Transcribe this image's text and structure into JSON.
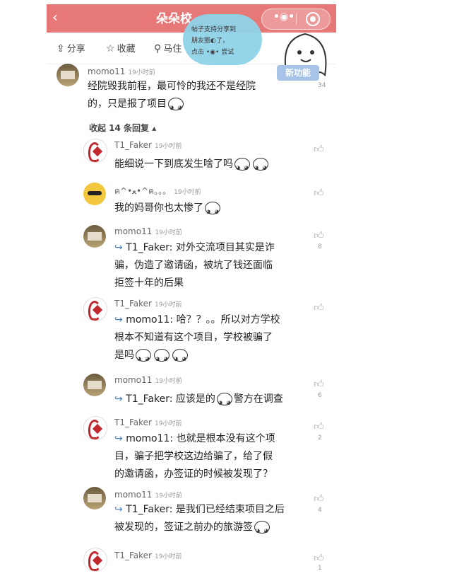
{
  "header": {
    "title": "朵朵校",
    "back_icon": "back-arrow-icon"
  },
  "actions": [
    {
      "label": "分享",
      "icon": "share-icon"
    },
    {
      "label": "收藏",
      "icon": "star-icon"
    },
    {
      "label": "马住",
      "icon": "pin-icon"
    }
  ],
  "tooltip": {
    "line1": "帖子支持分享到",
    "line2": "朋友圈",
    "line3": "了，",
    "line4": "点击",
    "line5": "尝试"
  },
  "new_feature_label": "新功能",
  "main_comment": {
    "name": "momo11",
    "time": "19小时前",
    "text_l1": "经院毁我前程，最可怜的我还不是经院",
    "text_l2": "的，只是报了项目",
    "like_count": "34"
  },
  "collapse_label": "收起 14 条回复 ▴",
  "replies": [
    {
      "name": "T1_Faker",
      "time": "19小时前",
      "l1": "能细说一下到底发生啥了吗",
      "reply_to": "",
      "l2": "",
      "l3": "",
      "likes": ""
    },
    {
      "name": "ฅ^•ﻌ•^ฅ。。。",
      "time": "19小时前",
      "l1": "我的妈哥你也太惨了",
      "reply_to": "",
      "l2": "",
      "l3": "",
      "likes": ""
    },
    {
      "name": "momo11",
      "time": "19小时前",
      "reply_to": "T1_Faker:",
      "l1": "对外交流项目其实是诈",
      "l2": "骗，伪造了邀请函，被坑了钱还面临",
      "l3": "拒签十年的后果",
      "likes": "8"
    },
    {
      "name": "T1_Faker",
      "time": "19小时前",
      "reply_to": "momo11:",
      "l1": "哈？？。。所以对方学校",
      "l2": "根本不知道有这个项目，学校被骗了",
      "l3": "是吗",
      "likes": ""
    },
    {
      "name": "momo11",
      "time": "19小时前",
      "reply_to": "T1_Faker:",
      "l1": "应该是的",
      "l1b": "警方在调查",
      "l2": "",
      "l3": "",
      "likes": "6"
    },
    {
      "name": "T1_Faker",
      "time": "19小时前",
      "reply_to": "momo11:",
      "l1": "也就是根本没有这个项",
      "l2": "目，骗子把学校这边给骗了，给了假",
      "l3": "的邀请函，办签证的时候被发现了？",
      "likes": "2"
    },
    {
      "name": "momo11",
      "time": "19小时前",
      "reply_to": "T1_Faker:",
      "l1": "是我们已经结束项目之后",
      "l2": "被发现的，签证之前办的旅游签",
      "l3": "",
      "likes": "4"
    },
    {
      "name": "T1_Faker",
      "time": "19小时前",
      "reply_to": "",
      "l1": "",
      "l2": "",
      "l3": "",
      "likes": "1"
    }
  ],
  "colors": {
    "topbar": "#e77878",
    "reply_arrow": "#4a7fc1",
    "bubble": "#8fd3e9"
  }
}
